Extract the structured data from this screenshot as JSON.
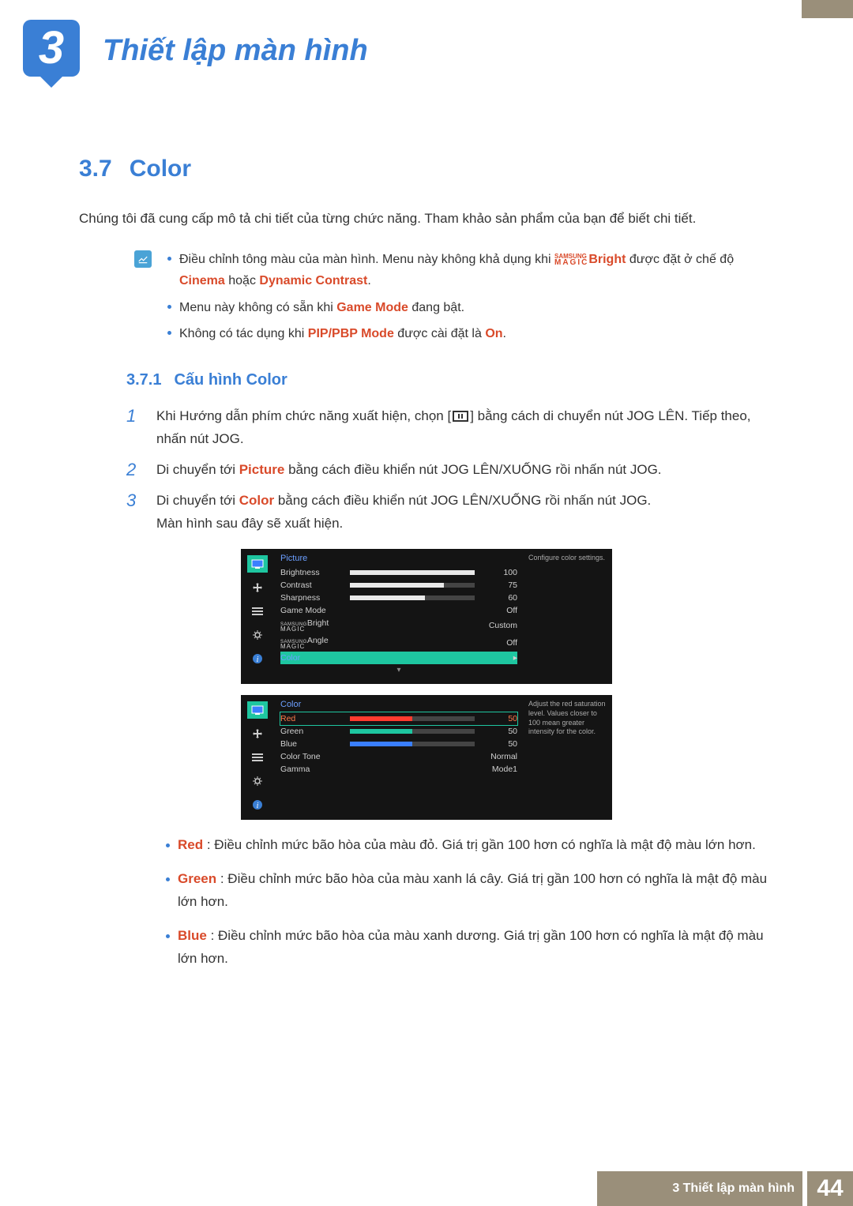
{
  "chapter": {
    "num": "3",
    "title": "Thiết lập màn hình"
  },
  "section": {
    "num": "3.7",
    "title": "Color"
  },
  "intro": "Chúng tôi đã cung cấp mô tả chi tiết của từng chức năng. Tham khảo sản phẩm của bạn để biết chi tiết.",
  "info": {
    "i1a": "Điều chỉnh tông màu của màn hình. Menu này không khả dụng khi ",
    "i1_bright": "Bright",
    "i1b": " được đặt ở chế độ ",
    "i1_cinema": "Cinema",
    "i1c": " hoặc ",
    "i1_dyn": "Dynamic Contrast",
    "i1d": ".",
    "i2a": "Menu này không có sẵn khi ",
    "i2_gm": "Game Mode",
    "i2b": " đang bật.",
    "i3a": "Không có tác dụng khi ",
    "i3_pip": "PIP/PBP Mode",
    "i3b": " được cài đặt là ",
    "i3_on": "On",
    "i3c": "."
  },
  "subsection": {
    "num": "3.7.1",
    "title": "Cấu hình Color"
  },
  "steps": {
    "s1n": "1",
    "s1a": "Khi Hướng dẫn phím chức năng xuất hiện, chọn [",
    "s1b": "] bằng cách di chuyển nút JOG LÊN. Tiếp theo, nhấn nút JOG.",
    "s2n": "2",
    "s2a": "Di chuyển tới ",
    "s2_pic": "Picture",
    "s2b": " bằng cách điều khiển nút JOG LÊN/XUỐNG rồi nhấn nút JOG.",
    "s3n": "3",
    "s3a": "Di chuyển tới ",
    "s3_col": "Color",
    "s3b": " bằng cách điều khiển nút JOG LÊN/XUỐNG rồi nhấn nút JOG.",
    "s3c": "Màn hình sau đây sẽ xuất hiện."
  },
  "osd1": {
    "title": "Picture",
    "hint": "Configure color settings.",
    "rows": {
      "brightness": {
        "l": "Brightness",
        "v": "100",
        "pct": 100
      },
      "contrast": {
        "l": "Contrast",
        "v": "75",
        "pct": 75
      },
      "sharpness": {
        "l": "Sharpness",
        "v": "60",
        "pct": 60
      },
      "game": {
        "l": "Game Mode",
        "v": "Off"
      },
      "mbright": {
        "suf": "Bright",
        "v": "Custom"
      },
      "mangle": {
        "suf": "Angle",
        "v": "Off"
      },
      "color": {
        "l": "Color"
      }
    }
  },
  "osd2": {
    "title": "Color",
    "hint": "Adjust the red saturation level. Values closer to 100 mean greater intensity for the color.",
    "rows": {
      "red": {
        "l": "Red",
        "v": "50",
        "pct": 50
      },
      "green": {
        "l": "Green",
        "v": "50",
        "pct": 50
      },
      "blue": {
        "l": "Blue",
        "v": "50",
        "pct": 50
      },
      "tone": {
        "l": "Color Tone",
        "v": "Normal"
      },
      "gamma": {
        "l": "Gamma",
        "v": "Mode1"
      }
    }
  },
  "magic": {
    "s": "SAMSUNG",
    "m": "MAGIC"
  },
  "desc": {
    "red_l": "Red",
    "red_t": " : Điều chỉnh mức bão hòa của màu đỏ. Giá trị gần 100 hơn có nghĩa là mật độ màu lớn hơn.",
    "green_l": "Green",
    "green_t": " : Điều chỉnh mức bão hòa của màu xanh lá cây. Giá trị gần 100 hơn có nghĩa là mật độ màu lớn hơn.",
    "blue_l": "Blue",
    "blue_t": " : Điều chỉnh mức bão hòa của màu xanh dương. Giá trị gần 100 hơn có nghĩa là mật độ màu lớn hơn."
  },
  "footer": {
    "chap": "3 Thiết lập màn hình",
    "page": "44"
  },
  "chart_data": [
    {
      "type": "table",
      "title": "Picture",
      "rows": [
        {
          "label": "Brightness",
          "value": 100,
          "slider": true
        },
        {
          "label": "Contrast",
          "value": 75,
          "slider": true
        },
        {
          "label": "Sharpness",
          "value": 60,
          "slider": true
        },
        {
          "label": "Game Mode",
          "value": "Off"
        },
        {
          "label": "SAMSUNG MAGIC Bright",
          "value": "Custom"
        },
        {
          "label": "SAMSUNG MAGIC Angle",
          "value": "Off"
        },
        {
          "label": "Color",
          "value": "",
          "highlighted": true
        }
      ],
      "hint": "Configure color settings."
    },
    {
      "type": "table",
      "title": "Color",
      "rows": [
        {
          "label": "Red",
          "value": 50,
          "slider": true,
          "selected": true
        },
        {
          "label": "Green",
          "value": 50,
          "slider": true
        },
        {
          "label": "Blue",
          "value": 50,
          "slider": true
        },
        {
          "label": "Color Tone",
          "value": "Normal"
        },
        {
          "label": "Gamma",
          "value": "Mode1"
        }
      ],
      "hint": "Adjust the red saturation level. Values closer to 100 mean greater intensity for the color."
    }
  ]
}
